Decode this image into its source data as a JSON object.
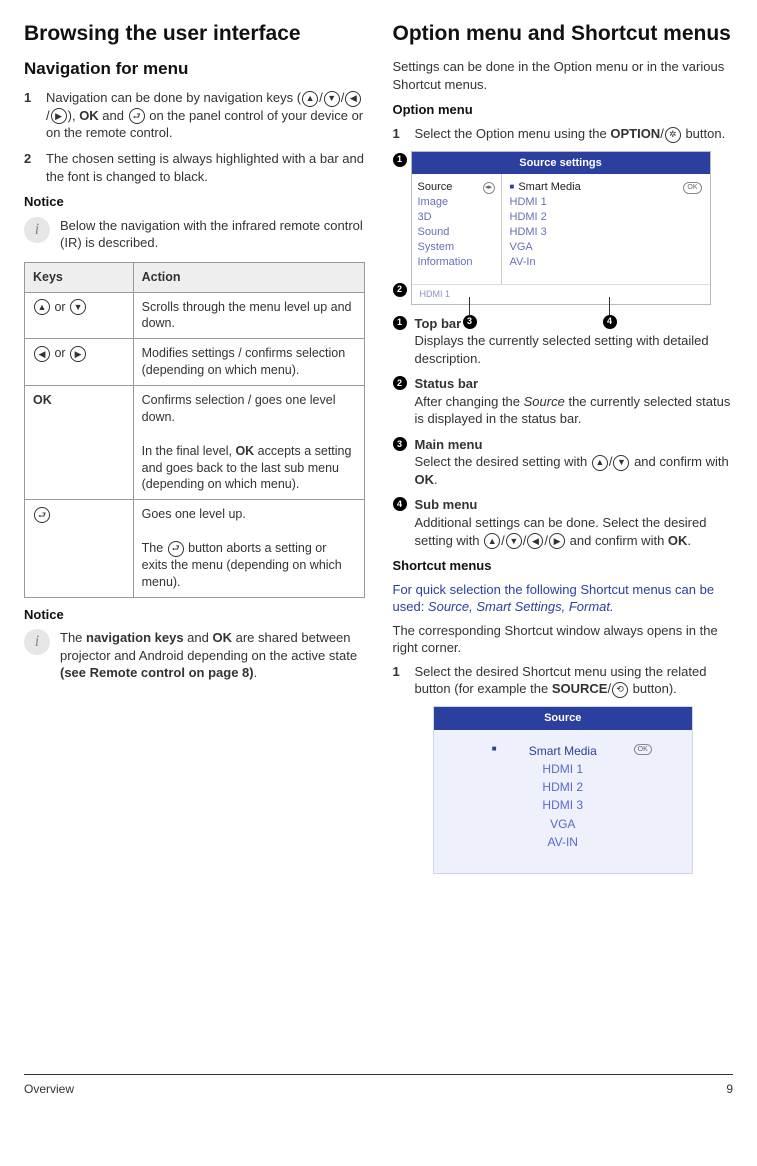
{
  "left": {
    "h1": "Browsing the user interface",
    "h2_nav": "Navigation for menu",
    "nav_steps": [
      "Navigation can be done by navigation keys (▲/▼/◀/▶), OK and ⮐ on the panel control of your device or on the remote control.",
      "The chosen setting is always highlighted with a bar and the font is changed to black."
    ],
    "notice1_title": "Notice",
    "notice1_text": "Below the navigation with the infrared remote control (IR) is described.",
    "table": {
      "head_keys": "Keys",
      "head_action": "Action",
      "rows": [
        {
          "keys_icons": [
            "▲",
            "▼"
          ],
          "keys_join": "or",
          "action": "Scrolls through the menu level up and down."
        },
        {
          "keys_icons": [
            "◀",
            "▶"
          ],
          "keys_join": "or",
          "action": "Modifies settings / confirms selection (depending on which menu)."
        },
        {
          "keys_text": "OK",
          "action": "Confirms selection / goes one level down.\nIn the final level, OK accepts a setting and goes back to the last sub menu (depending on which menu)."
        },
        {
          "keys_icons": [
            "⮐"
          ],
          "action": "Goes one level up.\nThe ⮐ button aborts a setting or exits the menu (depending on which menu)."
        }
      ]
    },
    "notice2_title": "Notice",
    "notice2_text_a": "The ",
    "notice2_bold_a": "navigation keys",
    "notice2_text_b": " and ",
    "notice2_bold_b": "OK",
    "notice2_text_c": " are shared between projector and Android depending on the active state ",
    "notice2_bold_c": "(see Remote control on page 8)",
    "notice2_text_d": "."
  },
  "right": {
    "h1": "Option menu and Shortcut menus",
    "intro": "Settings can be done in the Option menu or in the various Shortcut menus.",
    "h3_option": "Option menu",
    "option_step_a": "Select the Option menu using the ",
    "option_step_bold": "OPTION",
    "option_step_b": "/",
    "option_step_c": " button.",
    "fig_settings": {
      "title": "Source settings",
      "main": [
        "Source",
        "Image",
        "3D",
        "Sound",
        "System",
        "Information"
      ],
      "sub": [
        "Smart Media",
        "HDMI 1",
        "HDMI 2",
        "HDMI 3",
        "VGA",
        "AV-In"
      ],
      "status": "HDMI 1",
      "ok_label": "OK",
      "lr_label": "◂▸"
    },
    "callouts": [
      {
        "n": "1",
        "title": "Top bar",
        "text": "Displays the currently selected setting with detailed description."
      },
      {
        "n": "2",
        "title": "Status bar",
        "text_a": "After changing the ",
        "em": "Source",
        "text_b": " the currently selected status is displayed in the status bar."
      },
      {
        "n": "3",
        "title": "Main menu",
        "text": "Select the desired setting with ▲/▼ and confirm with OK."
      },
      {
        "n": "4",
        "title": "Sub menu",
        "text": "Additional settings can be done. Select the desired setting with ▲/▼/◀/▶ and confirm with OK."
      }
    ],
    "h3_shortcut": "Shortcut menus",
    "shortcut_intro_a": "For quick selection the following Shortcut menus can be used: ",
    "shortcut_intro_em": "Source, Smart Settings, Format.",
    "shortcut_para": "The corresponding Shortcut window always opens in the right corner.",
    "shortcut_step_a": "Select the desired Shortcut menu using the related button (for example the ",
    "shortcut_step_bold": "SOURCE",
    "shortcut_step_b": "/",
    "shortcut_step_c": " button).",
    "fig_shortcut": {
      "title": "Source",
      "items": [
        "Smart Media",
        "HDMI 1",
        "HDMI 2",
        "HDMI 3",
        "VGA",
        "AV-IN"
      ],
      "ok_label": "OK"
    }
  },
  "footer": {
    "section": "Overview",
    "page": "9"
  }
}
